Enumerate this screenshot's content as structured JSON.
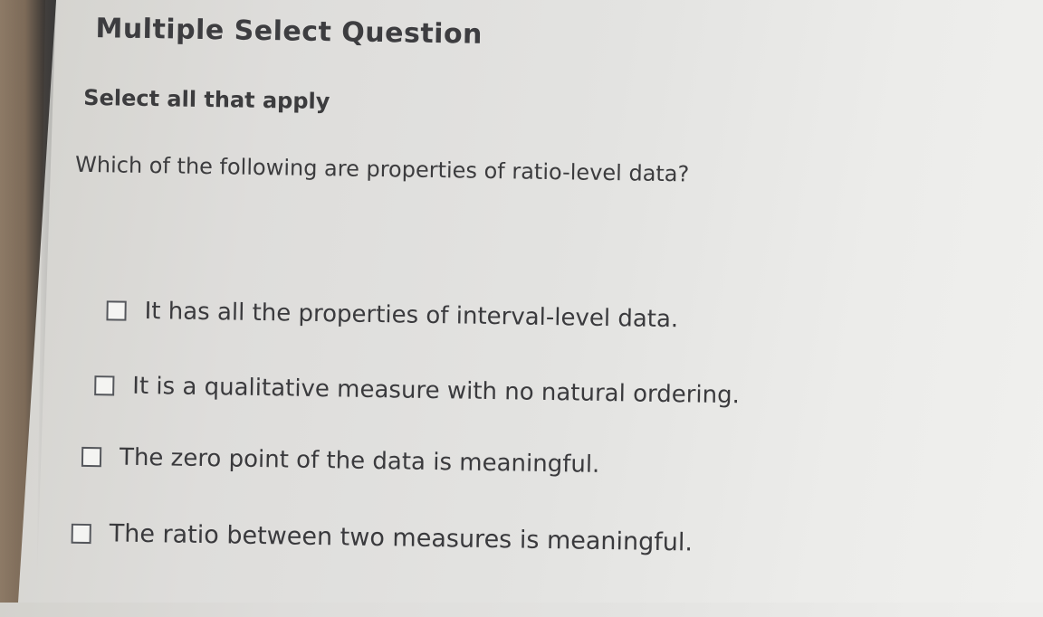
{
  "question": {
    "type_label": "Multiple Select Question",
    "instruction": "Select all that apply",
    "prompt": "Which of the following are properties of ratio-level data?",
    "options": [
      {
        "label": "It has all the properties of interval-level data.",
        "checked": false
      },
      {
        "label": "It is a qualitative measure with no natural ordering.",
        "checked": false
      },
      {
        "label": "The zero point of the data is meaningful.",
        "checked": false
      },
      {
        "label": "The ratio between two measures is meaningful.",
        "checked": false
      }
    ]
  },
  "colors": {
    "text": "#3a3a3d",
    "checkbox_border": "#55575c",
    "background": "#e3e3e1"
  }
}
